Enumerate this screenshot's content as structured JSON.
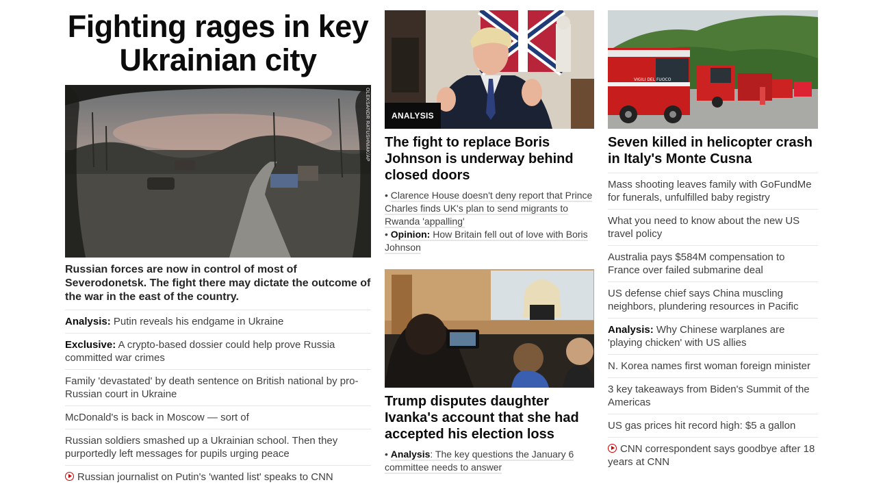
{
  "col1": {
    "title": "Fighting rages in key Ukrainian city",
    "image_credit": "OLEKSANDR RATUSHNIAK/AP",
    "description": "Russian forces are now in control of most of Severodonetsk. The fight there may dictate the outcome of the war in the east of the country.",
    "links": [
      {
        "prefix": "Analysis:",
        "text": " Putin reveals his endgame in Ukraine"
      },
      {
        "prefix": "Exclusive:",
        "text": " A crypto-based dossier could help prove Russia committed war crimes"
      },
      {
        "prefix": "",
        "text": "Family 'devastated' by death sentence on British national by pro-Russian court in Ukraine"
      },
      {
        "prefix": "",
        "text": "McDonald's is back in Moscow — sort of"
      },
      {
        "prefix": "",
        "text": "Russian soldiers smashed up a Ukrainian school. Then they purportedly left messages for pupils urging peace"
      },
      {
        "prefix": "",
        "text": "Russian journalist on Putin's 'wanted list' speaks to CNN",
        "icon": "play-icon"
      }
    ]
  },
  "col2": {
    "story1": {
      "badge": "ANALYSIS",
      "headline": "The fight to replace Boris Johnson is underway behind closed doors",
      "sub1": "Clarence House doesn't deny report that Prince Charles finds UK's plan to send migrants to Rwanda 'appalling'",
      "sub2_prefix": "Opinion:",
      "sub2": " How Britain fell out of love with Boris Johnson"
    },
    "story2": {
      "headline": "Trump disputes daughter Ivanka's account that she had accepted his election loss",
      "sub_prefix": "Analysis",
      "sub": ": The key questions the January 6 committee needs to answer"
    }
  },
  "col3": {
    "headline": "Seven killed in helicopter crash in Italy's Monte Cusna",
    "truck_label": "VIGILI DEL FUOCO",
    "links": [
      {
        "prefix": "",
        "text": "Mass shooting leaves family with GoFundMe for funerals, unfulfilled baby registry"
      },
      {
        "prefix": "",
        "text": "What you need to know about the new US travel policy"
      },
      {
        "prefix": "",
        "text": "Australia pays $584M compensation to France over failed submarine deal"
      },
      {
        "prefix": "",
        "text": "US defense chief says China muscling neighbors, plundering resources in Pacific"
      },
      {
        "prefix": "Analysis:",
        "text": " Why Chinese warplanes are 'playing chicken' with US allies"
      },
      {
        "prefix": "",
        "text": "N. Korea names first woman foreign minister"
      },
      {
        "prefix": "",
        "text": "3 key takeaways from Biden's Summit of the Americas"
      },
      {
        "prefix": "",
        "text": "US gas prices hit record high: $5 a gallon"
      },
      {
        "prefix": "",
        "text": "CNN correspondent says goodbye after 18 years at CNN",
        "icon": "play-icon"
      }
    ]
  },
  "colors": {
    "accent": "#cc0000",
    "text": "#0c0c0c",
    "muted": "#404040",
    "divider": "#e6e6e6"
  }
}
